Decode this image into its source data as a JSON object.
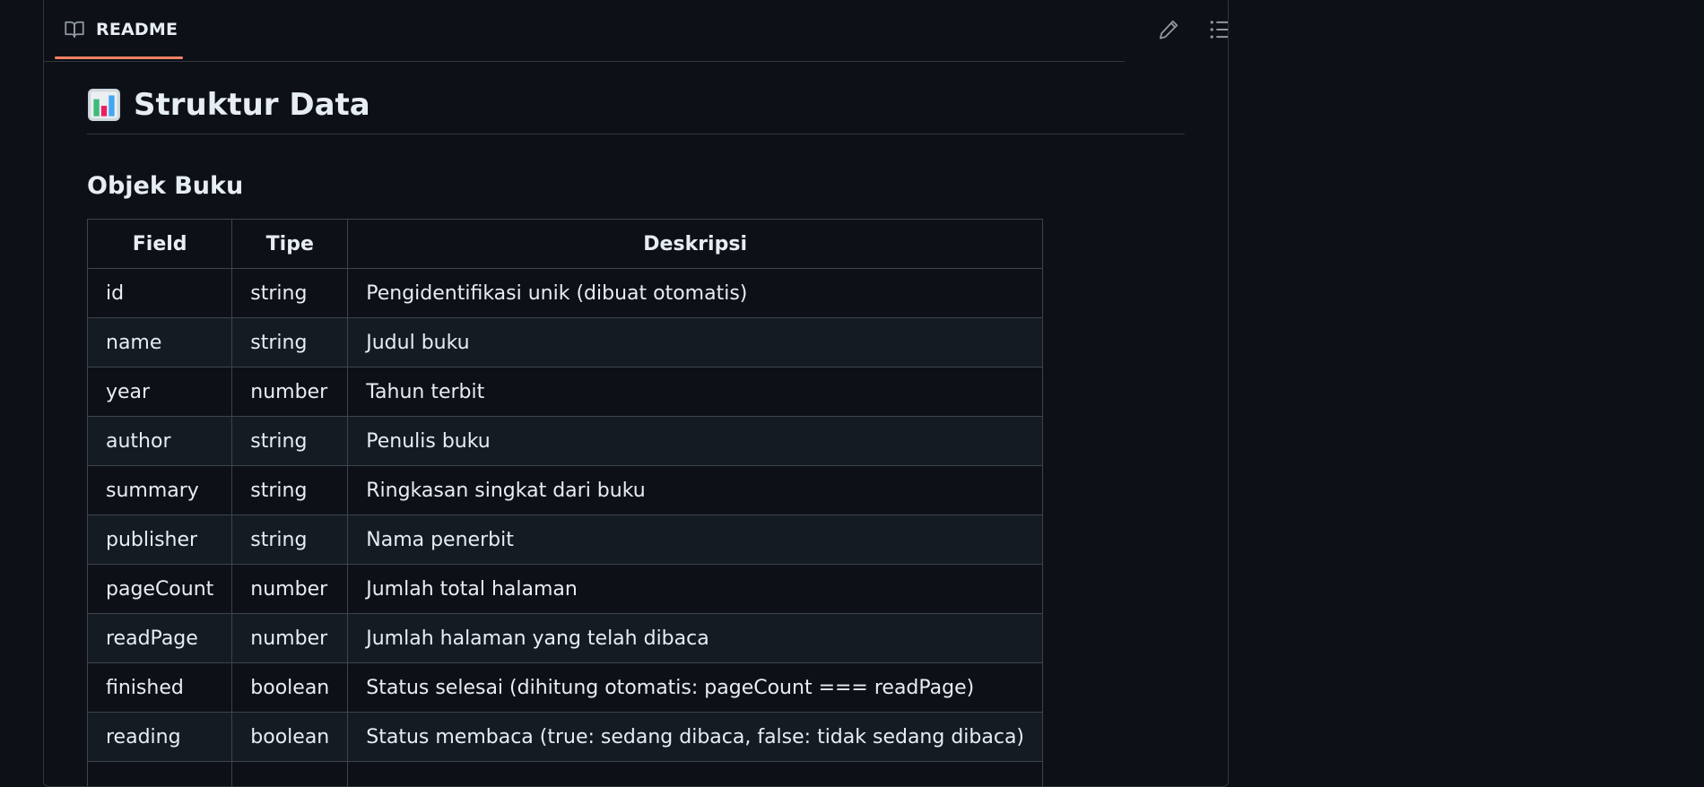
{
  "readme": {
    "tab_label": "README",
    "edit_icon": "pencil-icon",
    "outline_icon": "list-unordered-icon",
    "tab_icon": "book-icon"
  },
  "doc": {
    "heading": "Struktur Data",
    "heading_icon": "bar-chart-emoji-icon",
    "subheading": "Objek Buku",
    "table": {
      "headers": [
        "Field",
        "Tipe",
        "Deskripsi"
      ],
      "rows": [
        [
          "id",
          "string",
          "Pengidentifikasi unik (dibuat otomatis)"
        ],
        [
          "name",
          "string",
          "Judul buku"
        ],
        [
          "year",
          "number",
          "Tahun terbit"
        ],
        [
          "author",
          "string",
          "Penulis buku"
        ],
        [
          "summary",
          "string",
          "Ringkasan singkat dari buku"
        ],
        [
          "publisher",
          "string",
          "Nama penerbit"
        ],
        [
          "pageCount",
          "number",
          "Jumlah total halaman"
        ],
        [
          "readPage",
          "number",
          "Jumlah halaman yang telah dibaca"
        ],
        [
          "finished",
          "boolean",
          "Status selesai (dihitung otomatis: pageCount === readPage)"
        ],
        [
          "reading",
          "boolean",
          "Status membaca (true: sedang dibaca, false: tidak sedang dibaca)"
        ]
      ]
    }
  },
  "colors": {
    "background": "#0d1117",
    "border": "#30363d",
    "tab_accent": "#f78166",
    "text": "#e6edf3",
    "row_alt": "#151b23"
  }
}
